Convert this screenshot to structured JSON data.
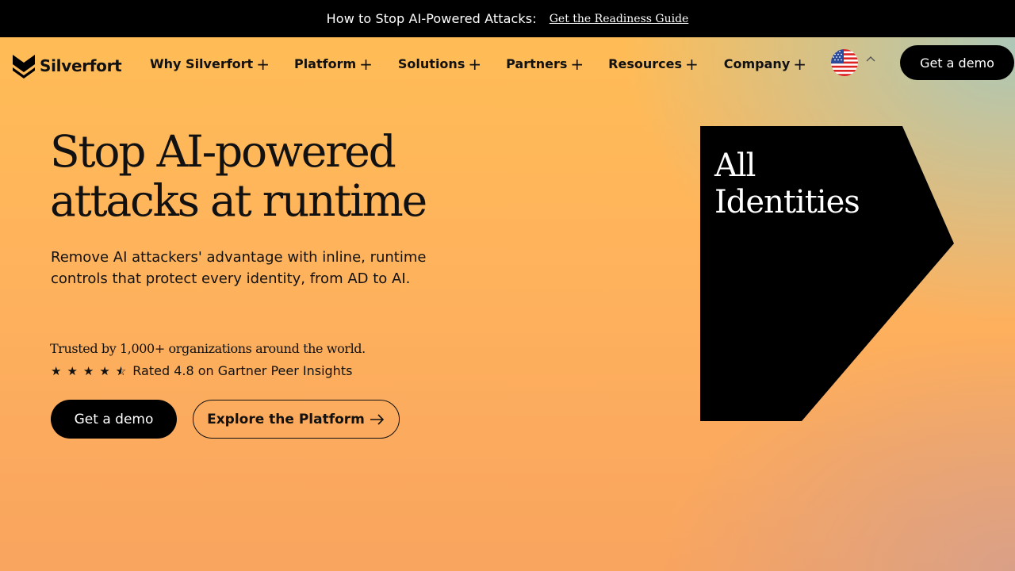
{
  "announcement": {
    "message": "How to Stop AI-Powered Attacks:",
    "link": "Get the Readiness Guide"
  },
  "header": {
    "brand": "Silverfort",
    "nav": [
      {
        "label": "Why Silverfort",
        "icon": "plus-icon"
      },
      {
        "label": "Platform",
        "icon": "plus-icon"
      },
      {
        "label": "Solutions",
        "icon": "plus-icon"
      },
      {
        "label": "Partners",
        "icon": "plus-icon"
      },
      {
        "label": "Resources",
        "icon": "plus-icon"
      },
      {
        "label": "Company",
        "icon": "plus-icon"
      }
    ],
    "language_icon": "us-flag-icon",
    "cta": "Get a demo"
  },
  "hero": {
    "title_line1": "Stop AI-powered",
    "title_line2": "attacks at runtime",
    "subtitle": "Remove AI attackers' advantage with inline, runtime controls that protect every identity, from AD to AI.",
    "trusted": "Trusted by 1,000+ organizations around the world.",
    "rating": {
      "stars": 4.5,
      "text": "Rated 4.8 on Gartner Peer Insights"
    },
    "primary_cta": "Get a demo",
    "secondary_cta": "Explore the Platform",
    "secondary_cta_icon": "arrow-right-icon"
  },
  "visual": {
    "line1": "All",
    "line2": "Identities"
  },
  "colors": {
    "accent": "#000000",
    "background_main": "#ffb85a",
    "background_corner": "#a8c8bc"
  }
}
